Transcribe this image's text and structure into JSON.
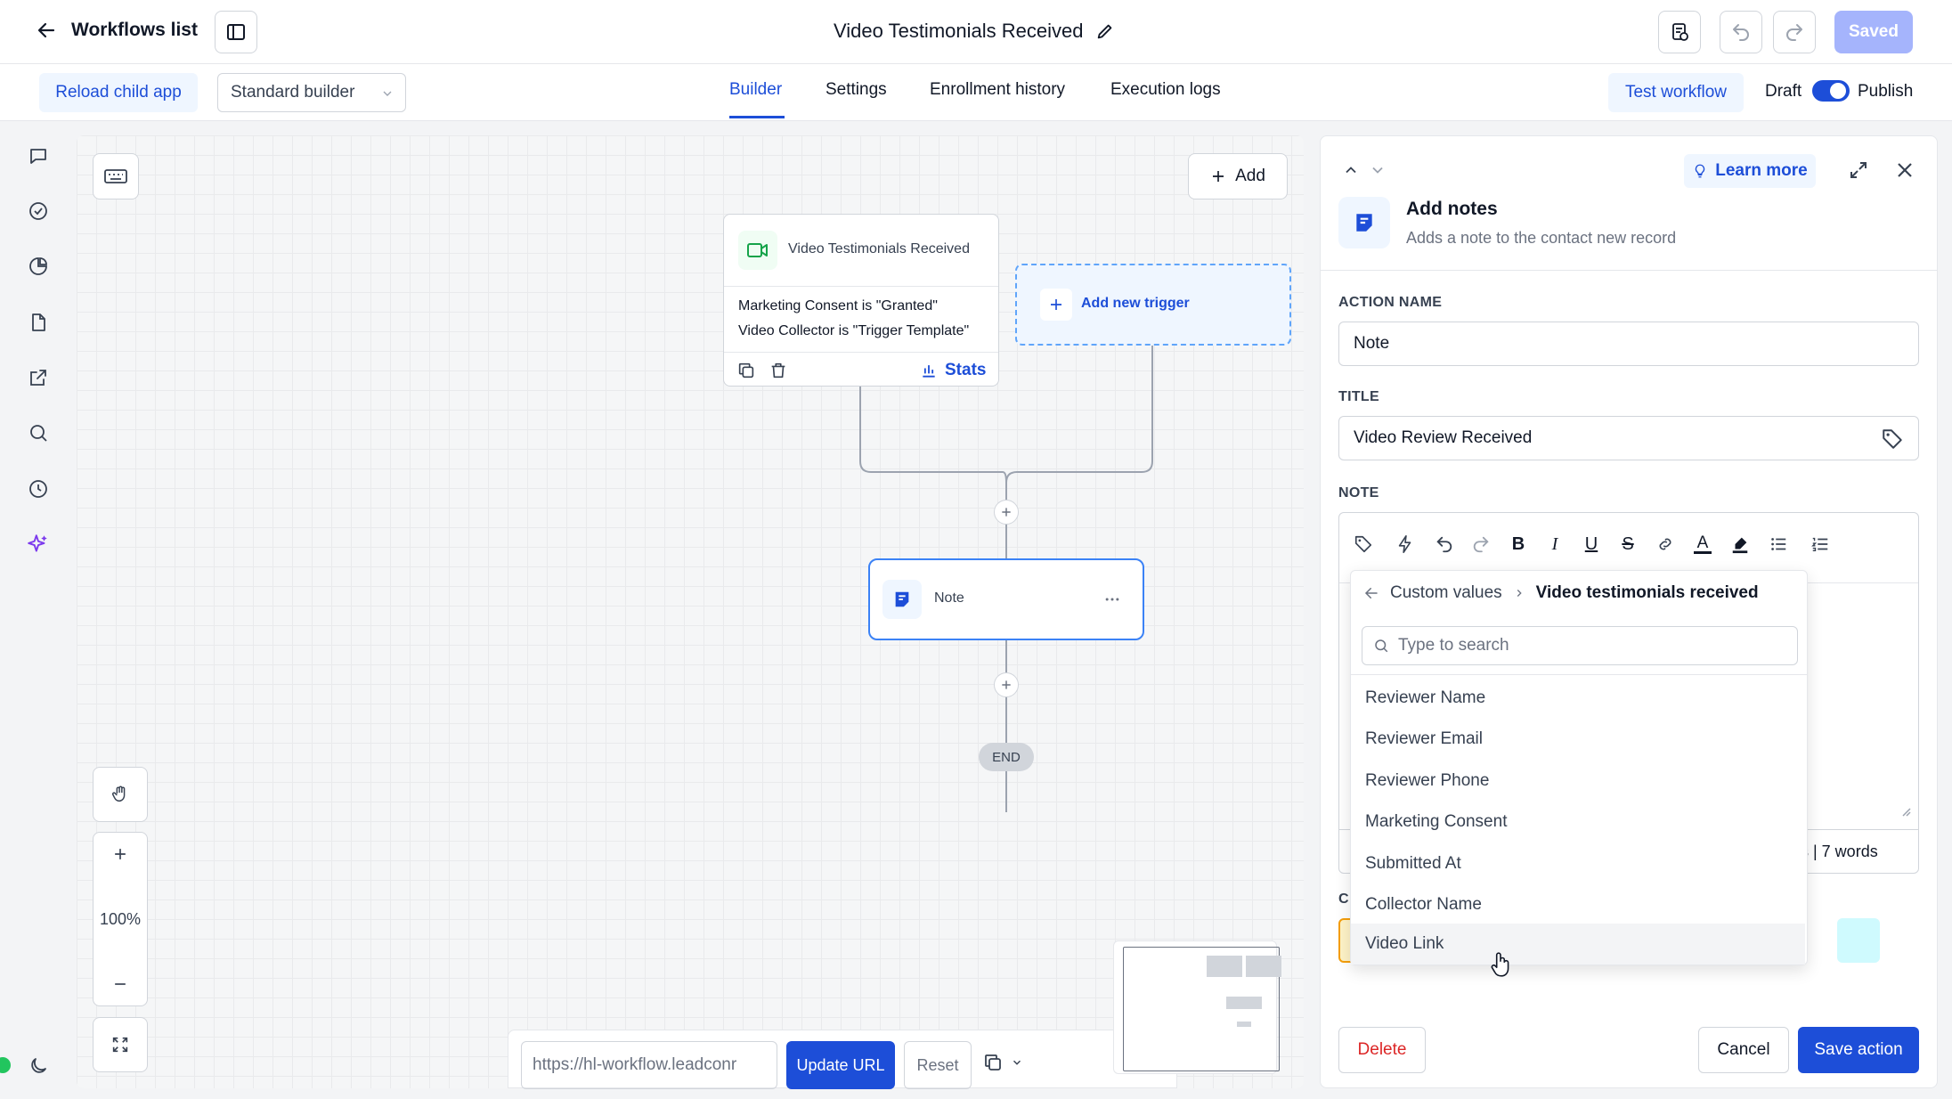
{
  "topbar": {
    "back_label": "Workflows list",
    "title": "Video Testimonials Received",
    "saved_label": "Saved"
  },
  "subbar": {
    "reload_label": "Reload child app",
    "builder_select": "Standard builder",
    "tabs": [
      "Builder",
      "Settings",
      "Enrollment history",
      "Execution logs"
    ],
    "test_label": "Test workflow",
    "draft_label": "Draft",
    "publish_label": "Publish"
  },
  "canvas": {
    "add_label": "Add",
    "trigger": {
      "title": "Video Testimonials Received",
      "line1": "Marketing Consent is \"Granted\"",
      "line2": "Video Collector is \"Trigger Template\"",
      "stats_label": "Stats"
    },
    "add_trigger_label": "Add new trigger",
    "note_node_label": "Note",
    "end_label": "END",
    "zoom_label": "100%",
    "url_value": "https://hl-workflow.leadconr",
    "update_url_label": "Update URL",
    "reset_label": "Reset"
  },
  "panel": {
    "title": "Add notes",
    "subtitle": "Adds a note to the contact new record",
    "learn_more_label": "Learn more",
    "action_name_label": "ACTION NAME",
    "action_name_value": "Note",
    "title_label": "TITLE",
    "title_value": "Video Review Received",
    "note_label": "NOTE",
    "counter_text": "rs | 7 words",
    "hidden_label_fragment": "C",
    "delete_label": "Delete",
    "cancel_label": "Cancel",
    "save_label": "Save action"
  },
  "dropdown": {
    "crumb_root": "Custom values",
    "crumb_current": "Video testimonials received",
    "search_placeholder": "Type to search",
    "items": [
      "Reviewer Name",
      "Reviewer Email",
      "Reviewer Phone",
      "Marketing Consent",
      "Submitted At",
      "Collector Name",
      "Video Link"
    ]
  },
  "colors": {
    "accent": "#1d4ed8",
    "accent_bg": "#eff6ff",
    "danger": "#dc2626",
    "saved_bg": "#a5b4fc"
  }
}
